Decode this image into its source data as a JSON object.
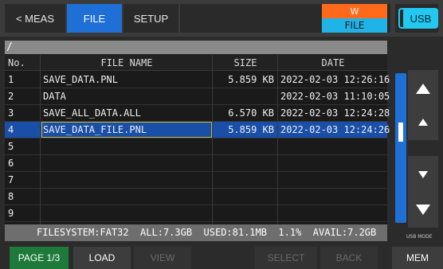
{
  "tabs": {
    "meas": "< MEAS",
    "file": "FILE",
    "setup": "SETUP"
  },
  "status_badge": {
    "top": "W",
    "bottom": "FILE"
  },
  "usb_button": "USB",
  "usb_mode_label": "USB MODE",
  "path": "/",
  "columns": {
    "no": "No.",
    "name": "FILE NAME",
    "size": "SIZE",
    "date": "DATE"
  },
  "files": [
    {
      "no": "1",
      "name": "SAVE_DATA.PNL",
      "size": "5.859 KB",
      "date": "2022-02-03 12:26:16"
    },
    {
      "no": "2",
      "name": "DATA",
      "size": "",
      "date": "2022-02-03 11:10:05"
    },
    {
      "no": "3",
      "name": "SAVE_ALL_DATA.ALL",
      "size": "6.570 KB",
      "date": "2022-02-03 12:24:28"
    },
    {
      "no": "4",
      "name": "SAVE_DATA_FILE.PNL",
      "size": "5.859 KB",
      "date": "2022-02-03 12:24:26",
      "selected": true
    },
    {
      "no": "5",
      "name": "",
      "size": "",
      "date": ""
    },
    {
      "no": "6",
      "name": "",
      "size": "",
      "date": ""
    },
    {
      "no": "7",
      "name": "",
      "size": "",
      "date": ""
    },
    {
      "no": "8",
      "name": "",
      "size": "",
      "date": ""
    },
    {
      "no": "9",
      "name": "",
      "size": "",
      "date": ""
    }
  ],
  "filesystem_status": "FILESYSTEM:FAT32  ALL:7.3GB  USED:81.1MB  1.1%  AVAIL:7.2GB",
  "bottom_buttons": {
    "page": "PAGE 1/3",
    "load": "LOAD",
    "view": "VIEW",
    "select": "SELECT",
    "back": "BACK",
    "mem": "MEM"
  },
  "colors": {
    "accent_blue": "#1e6fd6",
    "badge_orange": "#ff6a1a",
    "badge_cyan": "#1fb3e8",
    "usb_cyan": "#22c8f0",
    "page_green": "#1e7a3a"
  }
}
